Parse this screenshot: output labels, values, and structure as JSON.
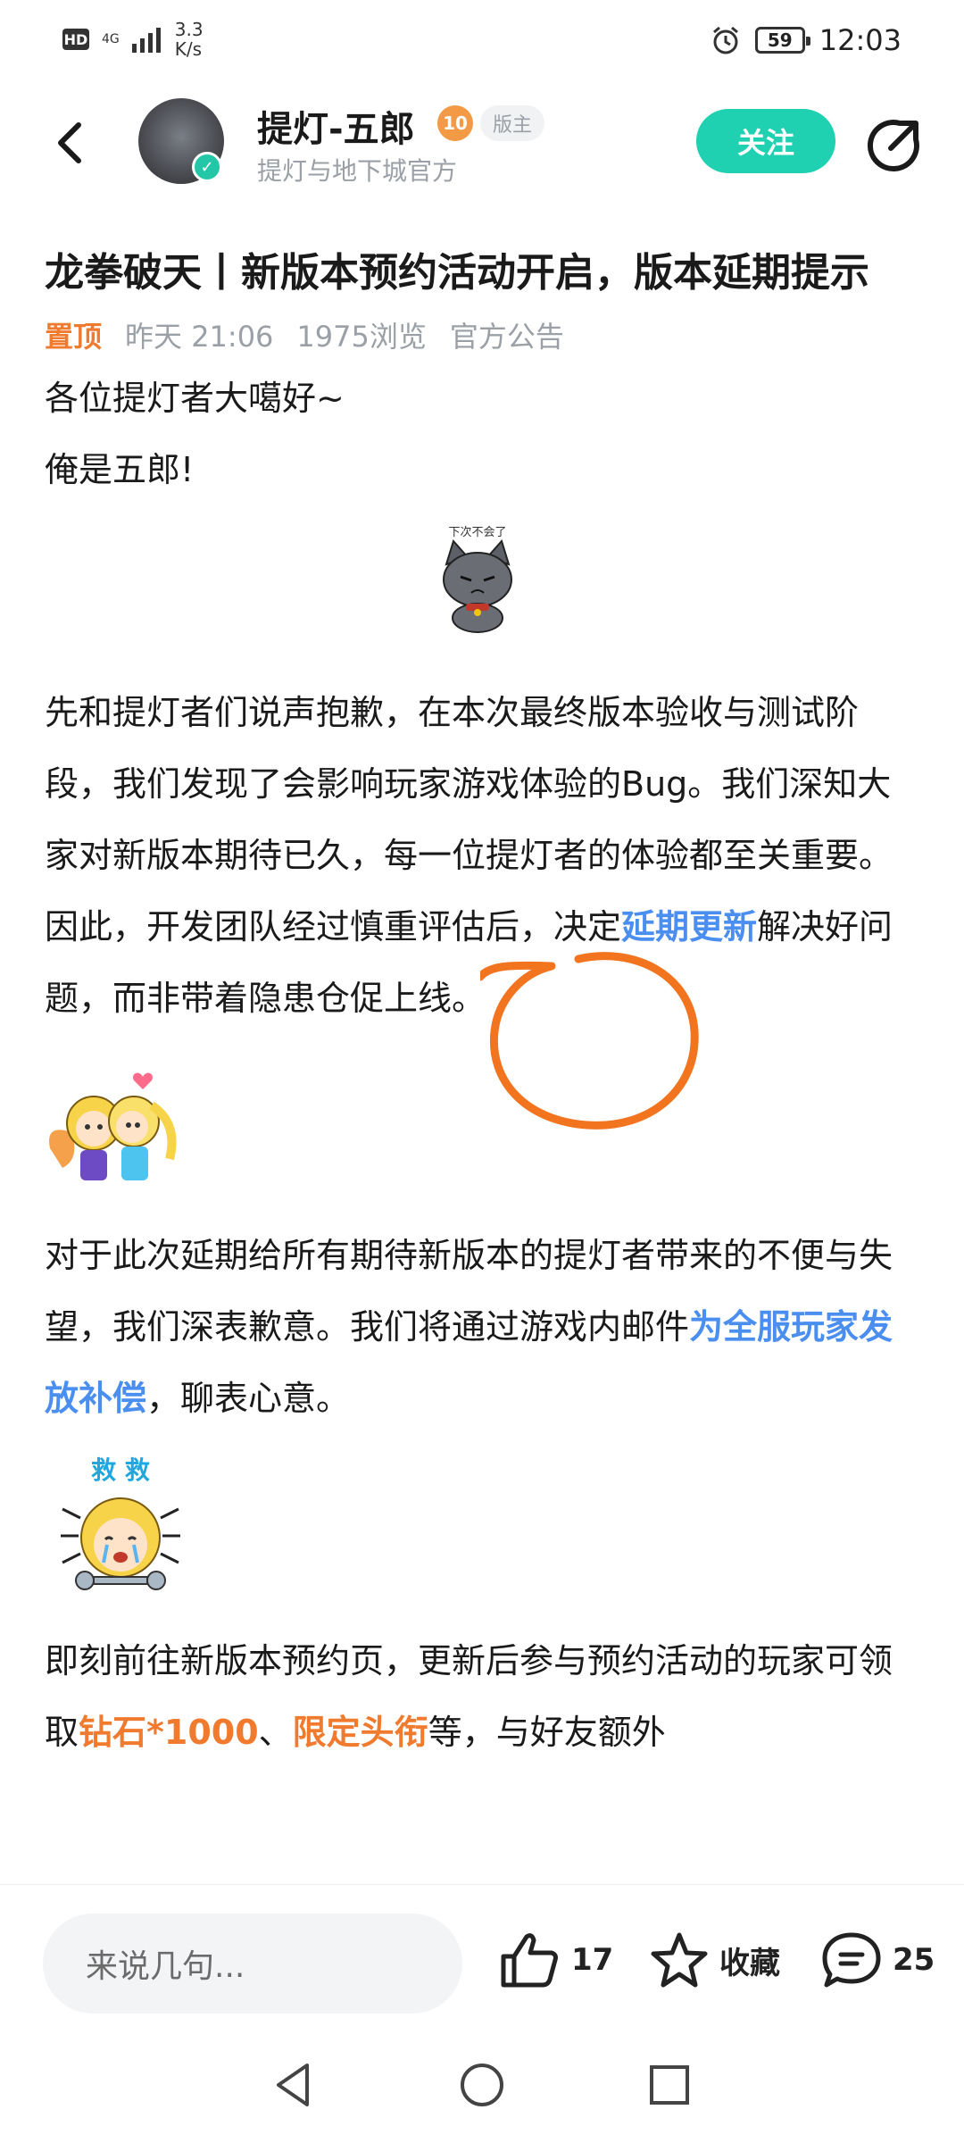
{
  "status_bar": {
    "hd": "HD",
    "network": "4G",
    "speed_value": "3.3",
    "speed_unit": "K/s",
    "battery": "59",
    "time": "12:03"
  },
  "header": {
    "author_name": "提灯-五郎",
    "level": "10",
    "role": "版主",
    "subtitle": "提灯与地下城官方",
    "follow_label": "关注"
  },
  "post": {
    "title": "龙拳破天丨新版本预约活动开启，版本延期提示",
    "pin_label": "置顶",
    "time": "昨天 21:06",
    "views": "1975浏览",
    "category": "官方公告",
    "p1": "各位提灯者大噶好~",
    "p2": "俺是五郎!",
    "sticker1_text": "下次不会了",
    "p3_a": "先和提灯者们说声抱歉，在本次最终版本验收与测试阶段，我们发现了会影响玩家游戏体验的Bug。我们深知大家对新版本期待已久，每一位提灯者的体验都至关重要。因此，开发团队经过慎重评估后，决定",
    "p3_link": "延期更新",
    "p3_b": "解决好问题，而非带着隐患仓促上线。",
    "p4_a": "对于此次延期给所有期待新版本的提灯者带来的不便与失望，我们深表歉意。我们将通过游戏内邮件",
    "p4_link": "为全服玩家发放补偿",
    "p4_b": "，聊表心意。",
    "sticker3_text": "救 救",
    "p5_a": "即刻前往新版本预约页，更新后参与预约活动的玩家可领取",
    "p5_link1": "钻石*1000",
    "p5_sep": "、",
    "p5_link2": "限定头衔",
    "p5_b": "等，与好友额外"
  },
  "bottom_bar": {
    "comment_placeholder": "来说几句...",
    "like_count": "17",
    "favorite_label": "收藏",
    "comment_count": "25"
  },
  "colors": {
    "accent": "#1fd1b0",
    "link_blue": "#4a8ef0",
    "highlight_orange": "#f07a2e"
  }
}
